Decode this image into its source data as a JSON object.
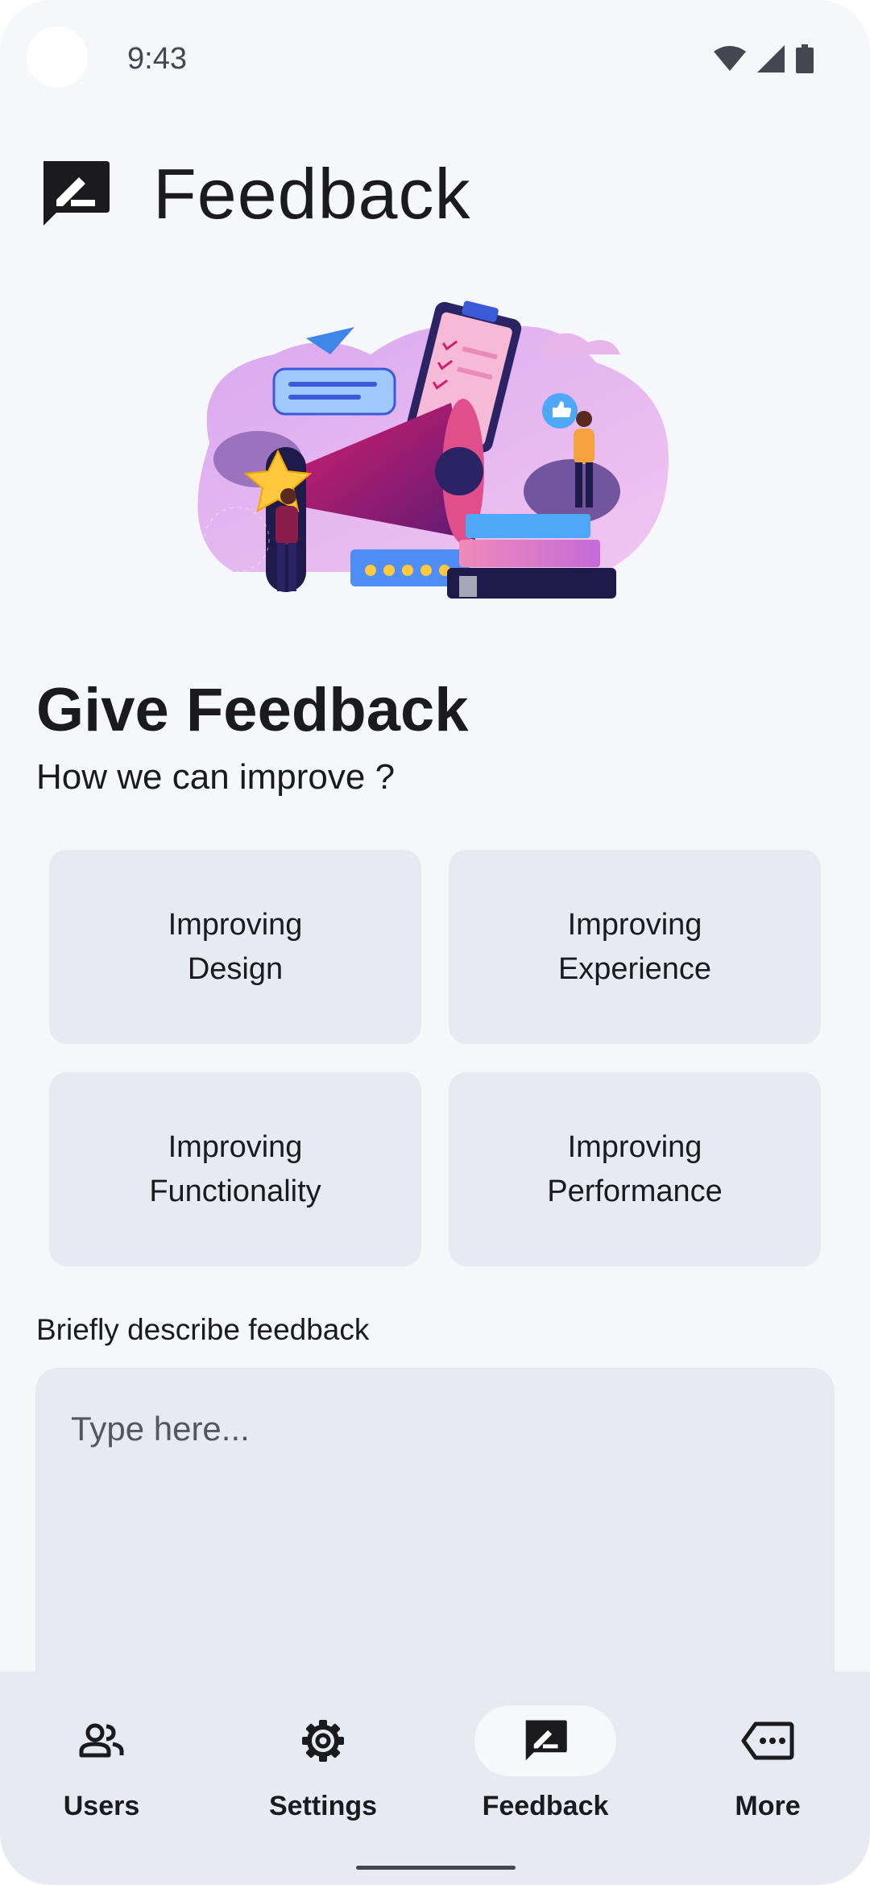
{
  "status_bar": {
    "time": "9:43"
  },
  "header": {
    "title": "Feedback",
    "icon": "feedback-icon"
  },
  "content": {
    "title": "Give Feedback",
    "subtitle": "How we can improve ?",
    "options": [
      {
        "label": "Improving\nDesign"
      },
      {
        "label": "Improving\nExperience"
      },
      {
        "label": "Improving\nFunctionality"
      },
      {
        "label": "Improving\nPerformance"
      }
    ],
    "describe_label": "Briefly describe feedback",
    "textarea_placeholder": "Type here..."
  },
  "bottom_nav": {
    "items": [
      {
        "label": "Users",
        "icon": "users-icon"
      },
      {
        "label": "Settings",
        "icon": "gear-icon"
      },
      {
        "label": "Feedback",
        "icon": "feedback-icon",
        "active": true
      },
      {
        "label": "More",
        "icon": "more-tag-icon"
      }
    ]
  },
  "colors": {
    "background": "#f6f7fb",
    "surface": "#e7eaf0",
    "text": "#1b1b1f",
    "accent_magenta": "#c2185b",
    "accent_purple": "#7b3fb0"
  }
}
